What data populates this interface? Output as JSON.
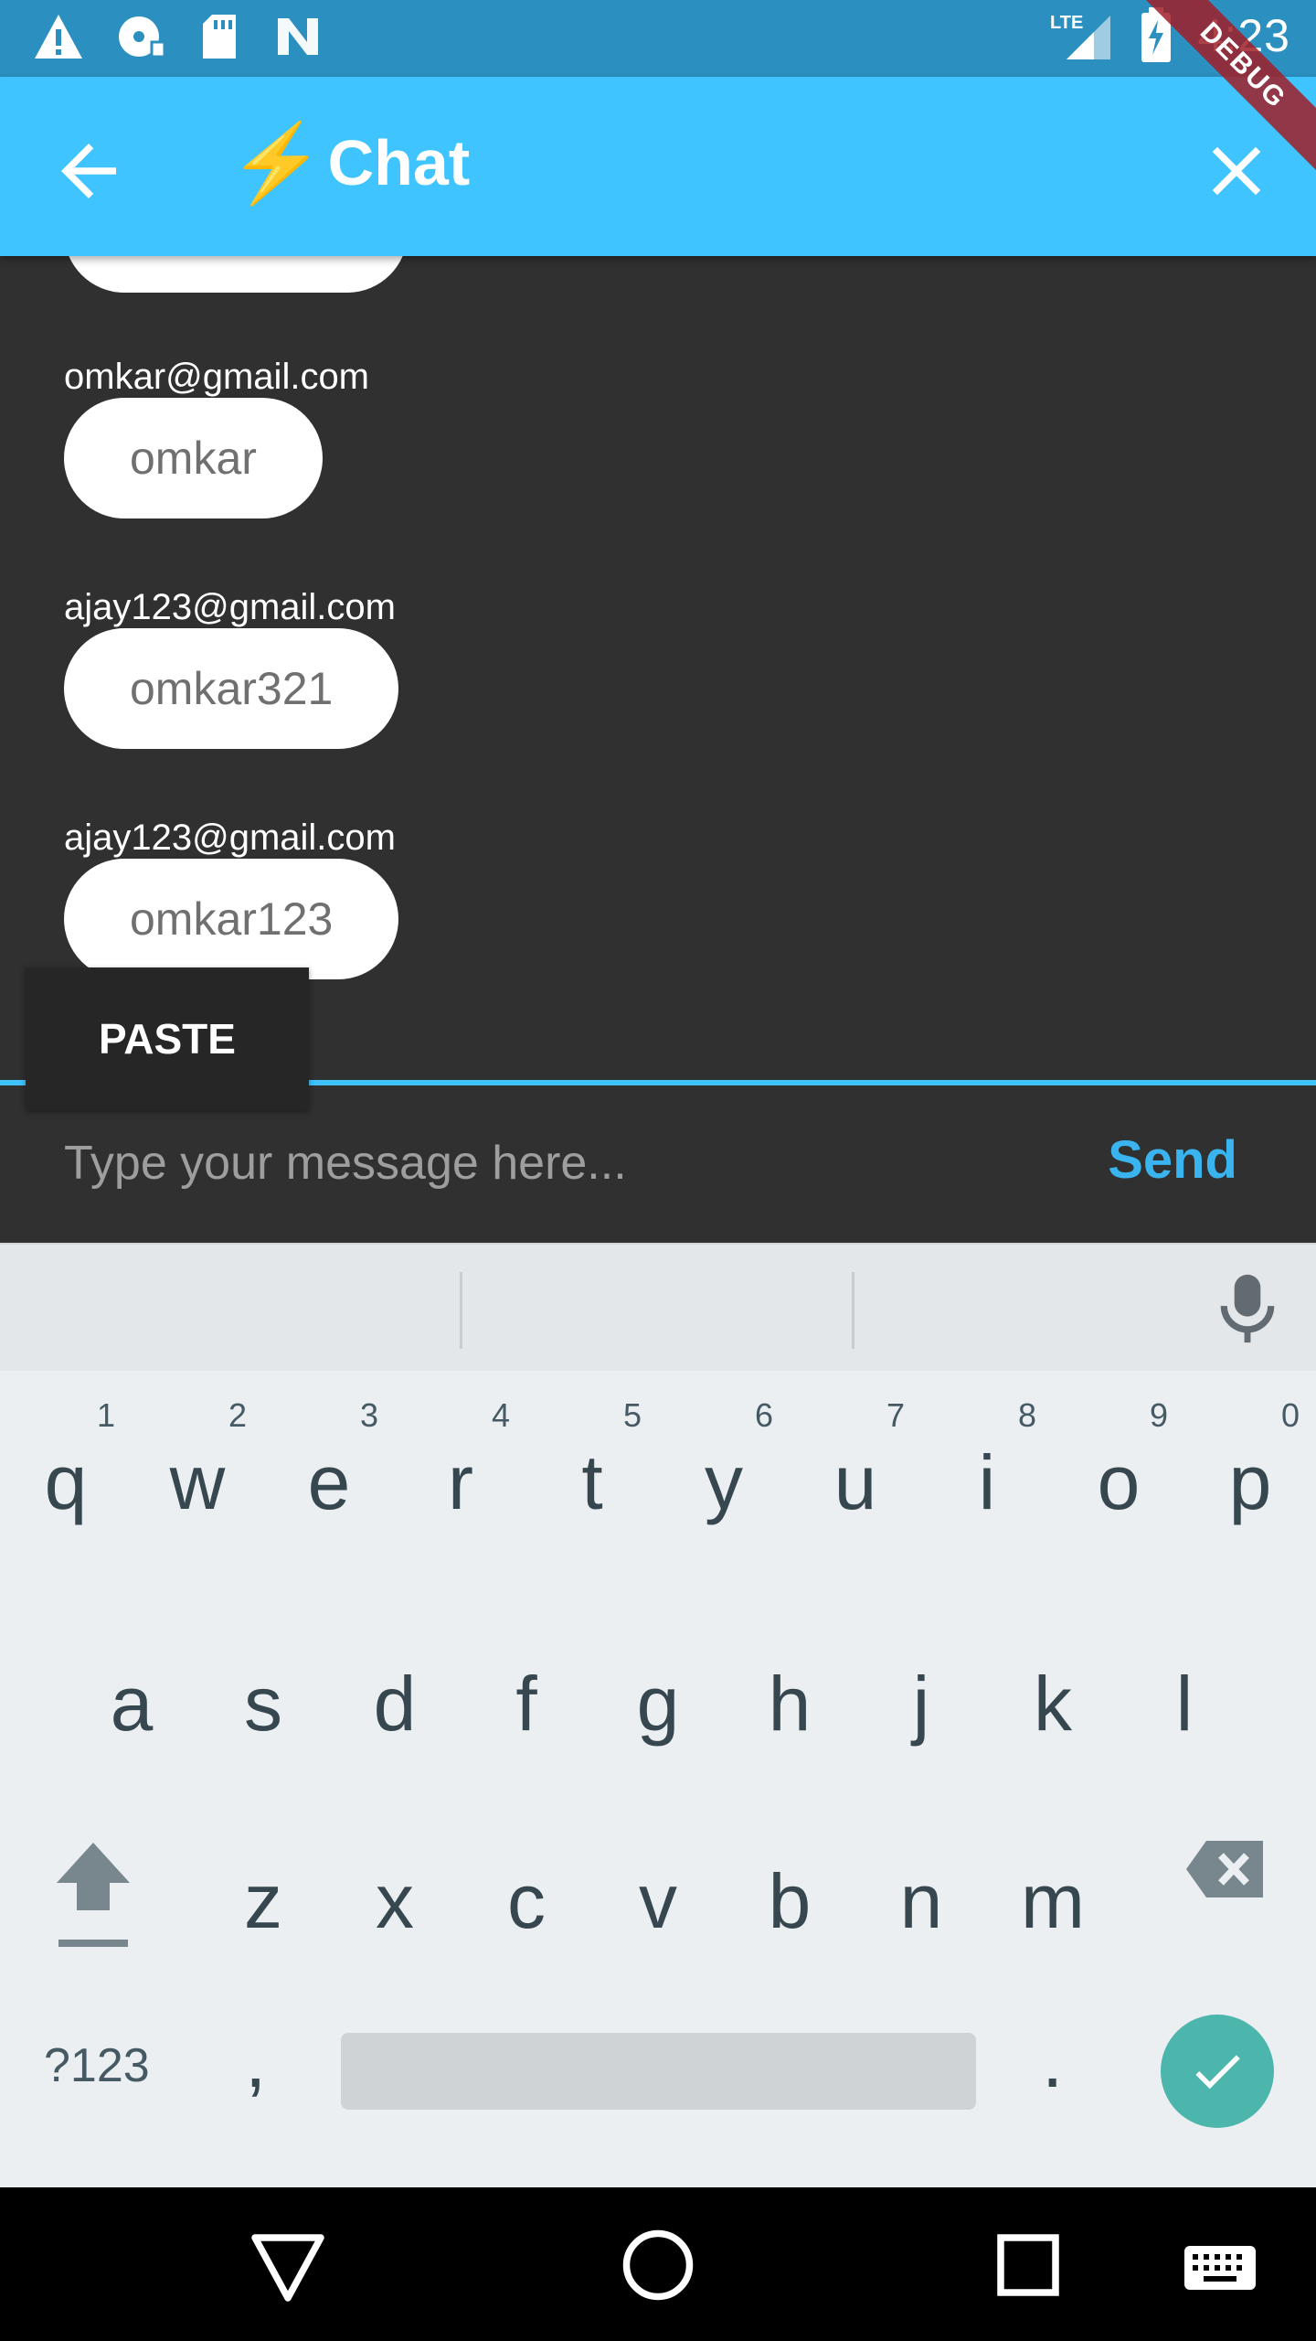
{
  "status_bar": {
    "time": "4:23",
    "network": "LTE",
    "icons": [
      "warning-icon",
      "sync-disc-icon",
      "sd-card-icon",
      "n-logo-icon",
      "lte-signal-icon",
      "battery-charging-icon"
    ],
    "debug_banner": "DEBUG"
  },
  "app_bar": {
    "title_emoji": "⚡",
    "title": "Chat",
    "back_icon": "back-arrow-icon",
    "close_icon": "close-icon",
    "color": "#40c4ff"
  },
  "messages": [
    {
      "sender": "",
      "text": ""
    },
    {
      "sender": "omkar@gmail.com",
      "text": "omkar"
    },
    {
      "sender": "ajay123@gmail.com",
      "text": "omkar321"
    },
    {
      "sender": "ajay123@gmail.com",
      "text": "omkar123"
    }
  ],
  "context_menu": {
    "paste_label": "PASTE"
  },
  "composer": {
    "placeholder": "Type your message here...",
    "value": "",
    "send_label": "Send",
    "accent": "#3ab4ef"
  },
  "keyboard": {
    "row1": [
      {
        "key": "q",
        "hint": "1"
      },
      {
        "key": "w",
        "hint": "2"
      },
      {
        "key": "e",
        "hint": "3"
      },
      {
        "key": "r",
        "hint": "4"
      },
      {
        "key": "t",
        "hint": "5"
      },
      {
        "key": "y",
        "hint": "6"
      },
      {
        "key": "u",
        "hint": "7"
      },
      {
        "key": "i",
        "hint": "8"
      },
      {
        "key": "o",
        "hint": "9"
      },
      {
        "key": "p",
        "hint": "0"
      }
    ],
    "row2": [
      "a",
      "s",
      "d",
      "f",
      "g",
      "h",
      "j",
      "k",
      "l"
    ],
    "row3": [
      "z",
      "x",
      "c",
      "v",
      "b",
      "n",
      "m"
    ],
    "symbols_label": "?123",
    "comma": ",",
    "period": ".",
    "done_color": "#4db6ac"
  }
}
